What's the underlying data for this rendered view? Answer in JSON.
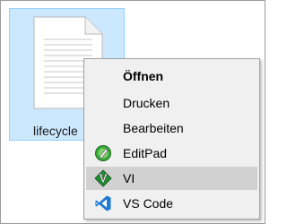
{
  "file": {
    "name": "lifecycle",
    "icon": "text-document-icon"
  },
  "context_menu": {
    "items": [
      {
        "label": "Öffnen",
        "bold": true,
        "icon": ""
      },
      {
        "label": "Drucken",
        "icon": ""
      },
      {
        "label": "Bearbeiten",
        "icon": ""
      },
      {
        "label": "EditPad",
        "icon": "editpad-icon"
      },
      {
        "label": "VI",
        "icon": "vim-icon",
        "hovered": true
      },
      {
        "label": "VS Code",
        "icon": "vscode-icon"
      }
    ]
  },
  "colors": {
    "selection_fill": "#cce8ff",
    "selection_border": "#99d1ff",
    "menu_background": "#f0f0f0",
    "menu_hover": "#d1d1d1",
    "vim_green": "#1f8f2f",
    "vscode_blue": "#1f7ad1"
  }
}
